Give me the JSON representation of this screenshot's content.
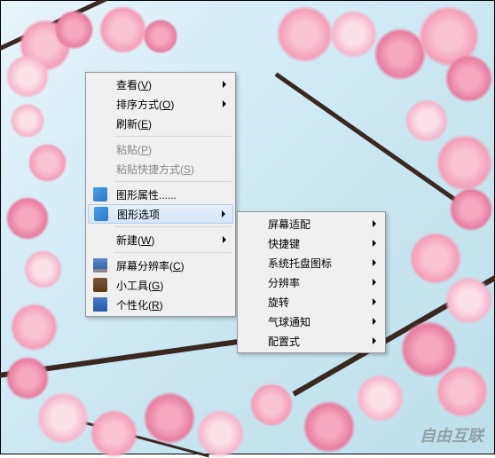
{
  "main_menu": {
    "view": {
      "label": "查看(",
      "key": "V",
      "suffix": ")"
    },
    "sort": {
      "label": "排序方式(",
      "key": "O",
      "suffix": ")"
    },
    "refresh": {
      "label": "刷新(",
      "key": "E",
      "suffix": ")"
    },
    "paste": {
      "label": "粘贴(",
      "key": "P",
      "suffix": ")"
    },
    "paste_shortcut": {
      "label": "粘贴快捷方式(",
      "key": "S",
      "suffix": ")"
    },
    "graphics_props": {
      "label": "图形属性......"
    },
    "graphics_options": {
      "label": "图形选项"
    },
    "new": {
      "label": "新建(",
      "key": "W",
      "suffix": ")"
    },
    "resolution": {
      "label": "屏幕分辨率(",
      "key": "C",
      "suffix": ")"
    },
    "gadgets": {
      "label": "小工具(",
      "key": "G",
      "suffix": ")"
    },
    "personalize": {
      "label": "个性化(",
      "key": "R",
      "suffix": ")"
    }
  },
  "sub_menu": {
    "screen_fit": "屏幕适配",
    "hotkeys": "快捷键",
    "tray_icon": "系统托盘图标",
    "resolution": "分辨率",
    "rotation": "旋转",
    "balloon": "气球通知",
    "profiles": "配置式"
  },
  "watermark": "自由互联"
}
